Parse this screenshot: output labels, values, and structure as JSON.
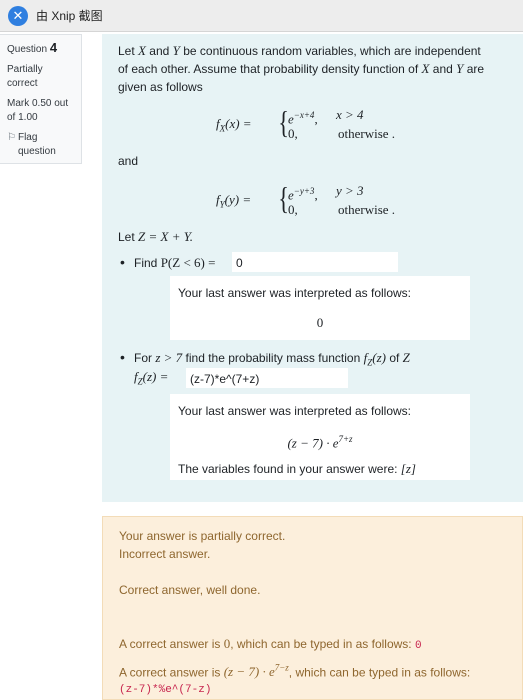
{
  "window": {
    "title": "由 Xnip 截图"
  },
  "sidebar": {
    "question_label": "Question",
    "question_number": "4",
    "status_line1": "Partially",
    "status_line2": "correct",
    "mark_line1": "Mark 0.50 out",
    "mark_line2": "of 1.00",
    "flag_line1": "Flag",
    "flag_line2": "question"
  },
  "question": {
    "intro_part1": "Let ",
    "var_x": "X",
    "intro_part2": " and ",
    "var_y": "Y",
    "intro_part3": " be continuous random variables, which are independent",
    "intro_line2_a": "of each other. Assume that probability density function of ",
    "intro_line2_b": "X",
    "intro_line2_c": " and ",
    "intro_line2_d": "Y",
    "intro_line2_e": " are",
    "intro_line3": "given as follows",
    "fx_lhs": "f",
    "fx_sub": "X",
    "fx_arg": "(x) =",
    "fx_case1_expr_base": "e",
    "fx_case1_expr_sup": "−x+4",
    "fx_case1_cond": "x > 4",
    "fx_case2_expr": "0,",
    "fx_case2_cond": "otherwise .",
    "and_text": "and",
    "fy_lhs": "f",
    "fy_sub": "Y",
    "fy_arg": "(y) =",
    "fy_case1_expr_base": "e",
    "fy_case1_expr_sup": "−y+3",
    "fy_case1_cond": "y > 3",
    "fy_case2_expr": "0,",
    "fy_case2_cond": "otherwise .",
    "let_z_prefix": "Let ",
    "let_z_expr": "Z = X + Y.",
    "part1_prefix": "Find ",
    "part1_expr": "P(Z < 6) =",
    "part1_answer": "0",
    "interp1_title": "Your last answer was interpreted as follows:",
    "interp1_value": "0",
    "part2_prefix": "For ",
    "part2_cond": "z > 7",
    "part2_middle": " find the probability mass function ",
    "part2_func": "f",
    "part2_func_sub": "Z",
    "part2_func_arg": "(z)",
    "part2_of": " of ",
    "part2_var": "Z",
    "part2_lhs": "f",
    "part2_lhs_sub": "Z",
    "part2_lhs_arg": "(z) =",
    "part2_answer": "(z-7)*e^(7+z)",
    "interp2_title": "Your last answer was interpreted as follows:",
    "interp2_value_base": "(z − 7) · e",
    "interp2_value_sup": "7+z",
    "interp2_vars_label": "The variables found in your answer were: ",
    "interp2_vars_value": "[z]"
  },
  "feedback": {
    "line1": "Your answer is partially correct.",
    "line2": "Incorrect answer.",
    "line3": "Correct answer, well done.",
    "correct1_prefix": "A correct answer is ",
    "correct1_math": "0",
    "correct1_suffix": ", which can be typed in as follows: ",
    "correct1_code": "0",
    "correct2_prefix": "A correct answer is ",
    "correct2_math_base": "(z − 7) · e",
    "correct2_math_sup": "7−z",
    "correct2_suffix": ", which can be typed in as follows:",
    "correct2_code": "(z-7)*%e^(7-z)"
  }
}
